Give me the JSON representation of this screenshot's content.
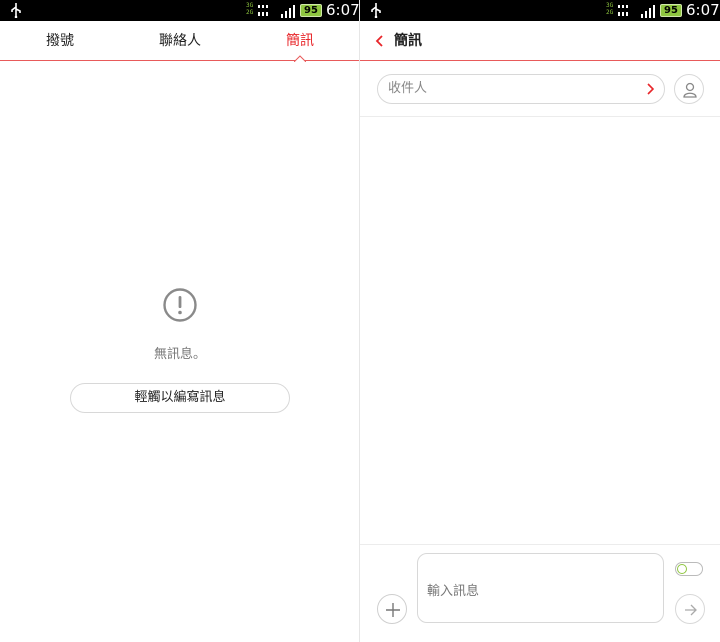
{
  "status_bar": {
    "network_top": "3G",
    "network_bottom": "2G",
    "battery": "95",
    "time": "6:07"
  },
  "left_screen": {
    "tabs": [
      {
        "label": "撥號"
      },
      {
        "label": "聯絡人"
      },
      {
        "label": "簡訊",
        "active": true
      }
    ],
    "empty_message": "無訊息。",
    "compose_button": "輕觸以編寫訊息",
    "icons": {
      "empty": "exclamation-circle-icon"
    }
  },
  "right_screen": {
    "title": "簡訊",
    "recipient_placeholder": "收件人",
    "message_placeholder": "輸入訊息",
    "icons": {
      "back": "chevron-left-icon",
      "recipient": "chevron-right-icon",
      "contact": "person-icon",
      "add": "plus-icon",
      "send": "arrow-right-icon"
    }
  },
  "colors": {
    "accent": "#e8262a",
    "status_green": "#8fc640",
    "status_bar_bg": "#000000"
  }
}
